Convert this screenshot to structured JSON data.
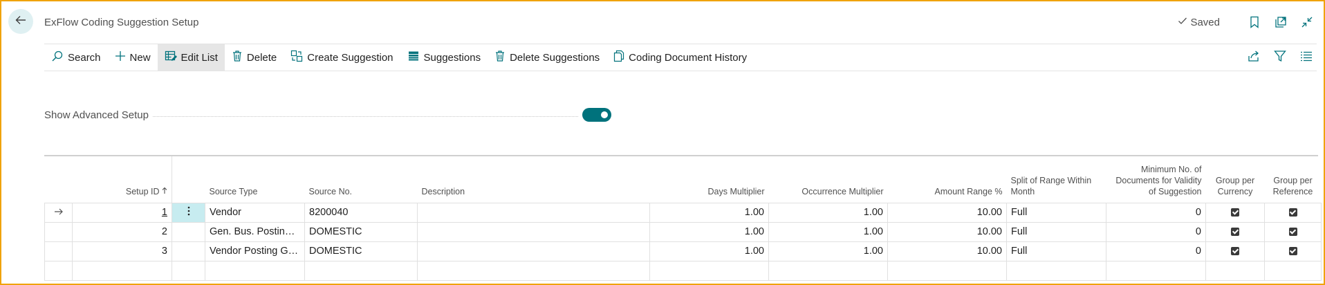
{
  "header": {
    "title": "ExFlow Coding Suggestion Setup",
    "saved_label": "Saved",
    "icons": [
      "back-arrow-icon",
      "bookmark-icon",
      "open-new-window-icon",
      "collapse-icon"
    ]
  },
  "actions": [
    {
      "label": "Search",
      "icon": "search-icon"
    },
    {
      "label": "New",
      "icon": "plus-icon"
    },
    {
      "label": "Edit List",
      "icon": "edit-list-icon",
      "active": true
    },
    {
      "label": "Delete",
      "icon": "trash-icon"
    },
    {
      "label": "Create Suggestion",
      "icon": "create-suggestion-icon"
    },
    {
      "label": "Suggestions",
      "icon": "table-icon"
    },
    {
      "label": "Delete Suggestions",
      "icon": "trash-icon"
    },
    {
      "label": "Coding Document History",
      "icon": "document-icon"
    }
  ],
  "action_right_icons": [
    "share-icon",
    "filter-icon",
    "list-view-icon"
  ],
  "advanced": {
    "label": "Show Advanced Setup",
    "enabled": true
  },
  "table": {
    "columns": {
      "setup_id": "Setup ID",
      "source_type": "Source Type",
      "source_no": "Source No.",
      "description": "Description",
      "days_multiplier": "Days Multiplier",
      "occurrence_multiplier": "Occurrence Multiplier",
      "amount_range": "Amount Range %",
      "split_range": "Split of Range Within Month",
      "min_docs": "Minimum No. of Documents for Validity of Suggestion",
      "group_currency": "Group per Currency",
      "group_reference": "Group per Reference"
    },
    "rows": [
      {
        "setup_id": "1",
        "source_type": "Vendor",
        "source_no": "8200040",
        "description": "",
        "days_multiplier": "1.00",
        "occurrence_multiplier": "1.00",
        "amount_range": "10.00",
        "split_range": "Full",
        "min_docs": "0",
        "group_currency": true,
        "group_reference": true
      },
      {
        "setup_id": "2",
        "source_type": "Gen. Bus. Posting G...",
        "source_no": "DOMESTIC",
        "description": "",
        "days_multiplier": "1.00",
        "occurrence_multiplier": "1.00",
        "amount_range": "10.00",
        "split_range": "Full",
        "min_docs": "0",
        "group_currency": true,
        "group_reference": true
      },
      {
        "setup_id": "3",
        "source_type": "Vendor Posting Gro...",
        "source_no": "DOMESTIC",
        "description": "",
        "days_multiplier": "1.00",
        "occurrence_multiplier": "1.00",
        "amount_range": "10.00",
        "split_range": "Full",
        "min_docs": "0",
        "group_currency": true,
        "group_reference": true
      }
    ],
    "selected_row": 0,
    "sort_indicator": "ascending"
  },
  "colors": {
    "accent": "#00727c",
    "frame": "#f0a30a",
    "back_button_bg": "#dff0f2",
    "selected_cell": "#c7ecf0"
  }
}
